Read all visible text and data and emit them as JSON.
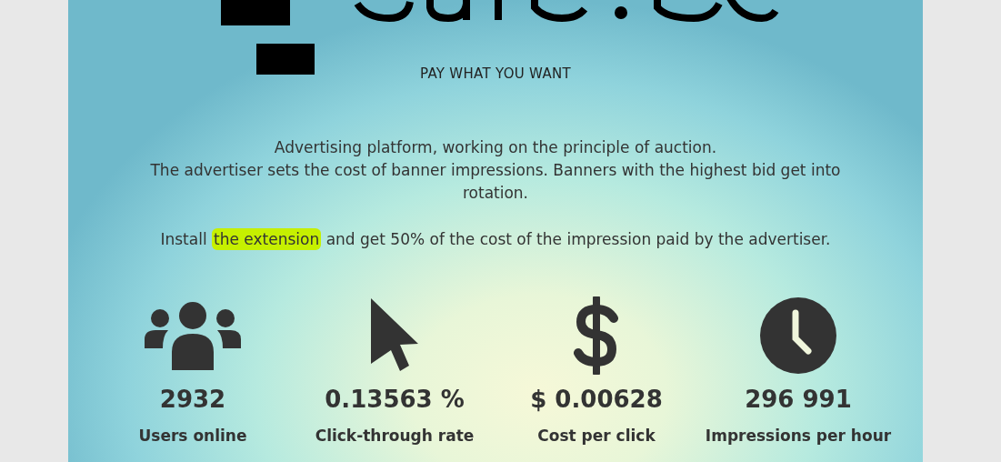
{
  "header": {
    "tagline": "PAY WHAT YOU WANT"
  },
  "intro": {
    "lines": [
      "Advertising platform, working on the principle of auction.",
      "The advertiser sets the cost of banner impressions. Banners with the highest bid get into rotation."
    ]
  },
  "install": {
    "before": "Install",
    "link": "the extension",
    "after": "and get 50% of the cost of the impression paid by the advertiser.",
    "highlighted": true
  },
  "stats": [
    {
      "kind": "users",
      "value": "2932",
      "label": "Users online"
    },
    {
      "kind": "pointer",
      "value": "0.13563 %",
      "label": "Click-through rate"
    },
    {
      "kind": "dollar",
      "value": "$ 0.00628",
      "label": "Cost per click"
    },
    {
      "kind": "clock",
      "value": "296 991",
      "label": "Impressions per hour"
    }
  ]
}
